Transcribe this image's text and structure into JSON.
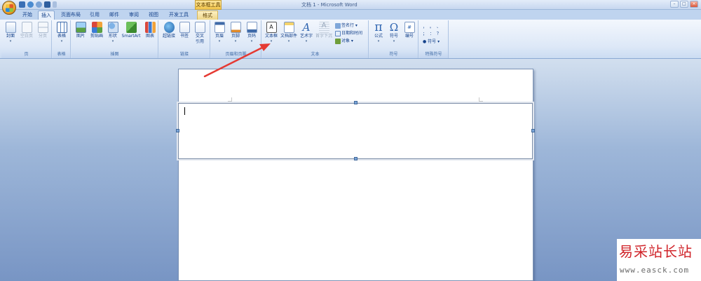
{
  "titlebar": {
    "context_tool": "文本框工具",
    "document_title": "文档 1 - Microsoft Word",
    "controls": [
      "–",
      "□",
      "×"
    ]
  },
  "tabs": [
    "开始",
    "插入",
    "页面布局",
    "引用",
    "邮件",
    "审阅",
    "视图",
    "开发工具",
    "格式"
  ],
  "active_tab": "插入",
  "ribbon": {
    "pages_group": {
      "label": "页",
      "cover": "封面",
      "blank_page": "空白页",
      "page_break": "分页"
    },
    "tables_group": {
      "label": "表格",
      "table": "表格"
    },
    "illustrations_group": {
      "label": "插图",
      "picture": "图片",
      "clipart": "剪贴画",
      "shapes": "形状",
      "smartart": "SmartArt",
      "chart": "图表"
    },
    "links_group": {
      "label": "链接",
      "hyperlink": "超链接",
      "bookmark": "书签",
      "cross_ref_line1": "交叉",
      "cross_ref_line2": "引用"
    },
    "header_footer_group": {
      "label": "页眉和页脚",
      "header": "页眉",
      "footer": "页脚",
      "page_number": "页码"
    },
    "text_group": {
      "label": "文本",
      "textbox": "文本框",
      "quick_parts": "文档部件",
      "wordart": "艺术字",
      "dropcap": "首字下沉",
      "signature_line": "签名行",
      "date_time": "日期和时间",
      "object": "对象"
    },
    "symbols_group": {
      "label": "符号",
      "equation": "公式",
      "symbol": "符号",
      "numbering": "编号"
    },
    "special_symbols_group": {
      "label": "特殊符号",
      "row1": "，  。  、",
      "row2": "；  ：  ？",
      "symbol_dropdown": "符号"
    }
  },
  "watermark": {
    "name": "易采站长站",
    "url": "www.easck.com"
  },
  "colors": {
    "ribbon_text": "#15428b",
    "arrow": "#e53a33",
    "watermark_red": "#d0242a"
  }
}
